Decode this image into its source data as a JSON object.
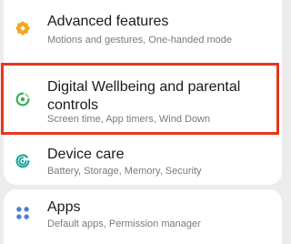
{
  "settings": {
    "items": [
      {
        "title": "Advanced features",
        "subtitle": "Motions and gestures, One-handed mode",
        "icon": "gear-plus-icon",
        "icon_color": "#f4a522"
      },
      {
        "title": "Digital Wellbeing and parental controls",
        "subtitle": "Screen time, App timers, Wind Down",
        "icon": "wellbeing-icon",
        "icon_color": "#3fae5a"
      },
      {
        "title": "Device care",
        "subtitle": "Battery, Storage, Memory, Security",
        "icon": "device-care-icon",
        "icon_color": "#1aa39a"
      },
      {
        "title": "Apps",
        "subtitle": "Default apps, Permission manager",
        "icon": "apps-grid-icon",
        "icon_color": "#4a7fd6"
      }
    ],
    "highlight_color": "#e8361e"
  }
}
